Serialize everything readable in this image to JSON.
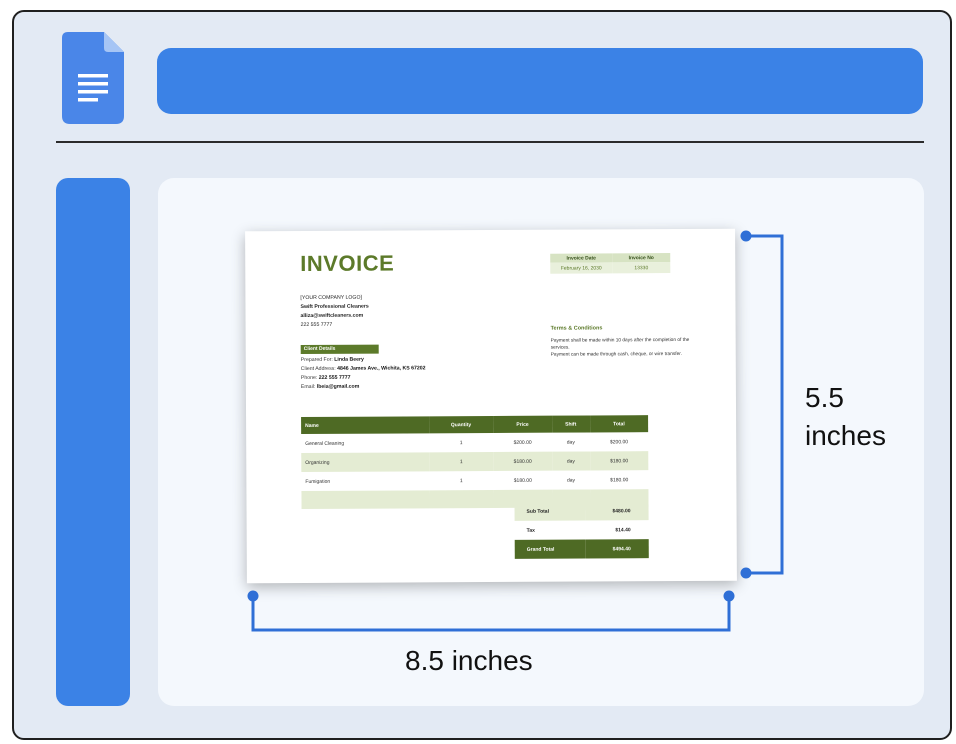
{
  "app": {
    "icon": "google-docs-icon",
    "accent": "#3b82e6"
  },
  "invoice": {
    "title": "INVOICE",
    "meta": {
      "date_label": "Invoice Date",
      "number_label": "Invoice No",
      "date_value": "February 16, 2030",
      "number_value": "13330"
    },
    "company": {
      "logo": "[YOUR COMPANY LOGO]",
      "name": "Swift Professional Cleaners",
      "email": "alliza@swiftcleaners.com",
      "phone": "222 555 7777"
    },
    "client": {
      "header": "Client Details",
      "prepared_for_label": "Prepared For:",
      "prepared_for": "Linda Beery",
      "address_label": "Client Address:",
      "address": "4846 James Ave., Wichita, KS 67202",
      "phone_label": "Phone:",
      "phone": "222 555 7777",
      "email_label": "Email:",
      "email": "lbeia@gmail.com"
    },
    "terms": {
      "title": "Terms & Conditions",
      "line1": "Payment shall be made within 10 days after the completion of the services.",
      "line2": "Payment can be made through cash, cheque, or wire transfer."
    },
    "columns": [
      "Name",
      "Quantity",
      "Price",
      "Shift",
      "Total"
    ],
    "rows": [
      [
        "General Cleaning",
        "1",
        "$200.00",
        "day",
        "$200.00"
      ],
      [
        "Organizing",
        "1",
        "$180.00",
        "day",
        "$180.00"
      ],
      [
        "Fumigation",
        "1",
        "$180.00",
        "day",
        "$180.00"
      ]
    ],
    "subtotal_label": "Sub Total",
    "subtotal": "$480.00",
    "tax_label": "Tax",
    "tax": "$14.40",
    "grand_label": "Grand Total",
    "grand": "$494.40",
    "theme_green": "#5c7a2a"
  },
  "dimensions": {
    "height_value": "5.5",
    "height_unit": "inches",
    "width_label": "8.5 inches",
    "line_color": "#2f6fd6"
  }
}
